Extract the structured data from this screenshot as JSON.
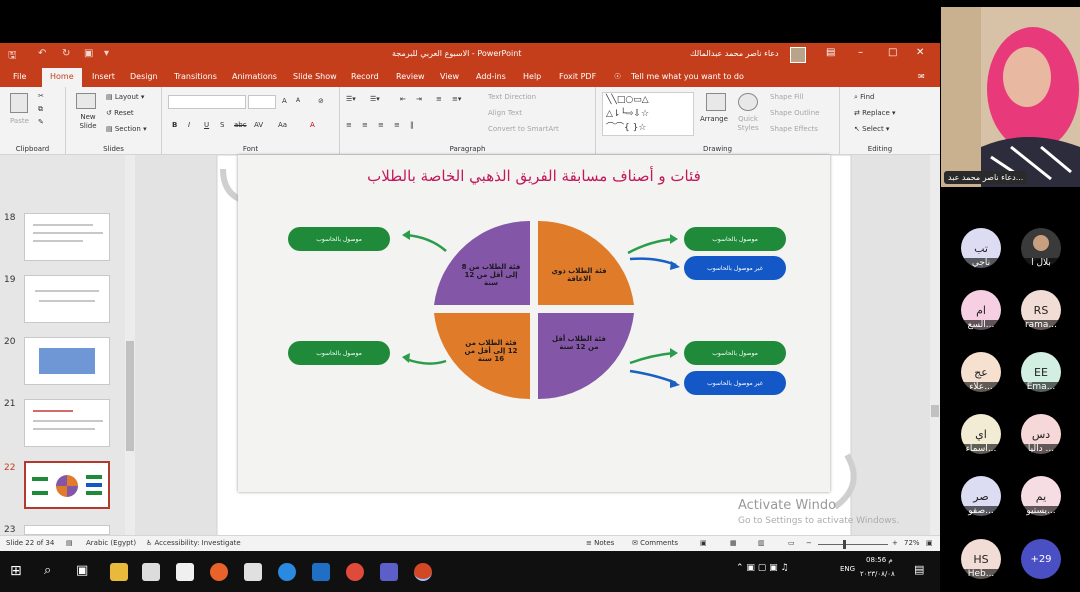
{
  "window": {
    "title": "الاسبوع العربي للبرمجة",
    "app_name": "PowerPoint",
    "user_name": "دعاء ناصر محمد عبدالمالك"
  },
  "tabs": [
    "File",
    "Home",
    "Insert",
    "Design",
    "Transitions",
    "Animations",
    "Slide Show",
    "Record",
    "Review",
    "View",
    "Add-ins",
    "Help",
    "Foxit PDF"
  ],
  "tell_me": "Tell me what you want to do",
  "ribbon": {
    "groups": [
      "Clipboard",
      "Slides",
      "Font",
      "Paragraph",
      "Drawing",
      "Editing"
    ],
    "clipboard": {
      "paste": "Paste"
    },
    "slides": {
      "new_slide": "New Slide",
      "layout": "Layout",
      "reset": "Reset",
      "section": "Section"
    },
    "font": {
      "bold": "B",
      "italic": "I",
      "underline": "U",
      "strike": "abc",
      "spacing": "AV",
      "case": "Aa",
      "grow": "A",
      "shrink": "A",
      "color": "A"
    },
    "paragraph": {
      "text_direction": "Text Direction",
      "align_text": "Align Text",
      "smartart": "Convert to SmartArt"
    },
    "drawing": {
      "arrange": "Arrange",
      "quick_styles": "Quick Styles",
      "fill": "Shape Fill",
      "outline": "Shape Outline",
      "effects": "Shape Effects"
    },
    "editing": {
      "find": "Find",
      "replace": "Replace",
      "select": "Select"
    }
  },
  "thumbnails": [
    {
      "num": "18",
      "selected": false
    },
    {
      "num": "19",
      "selected": false
    },
    {
      "num": "20",
      "selected": false
    },
    {
      "num": "21",
      "selected": false
    },
    {
      "num": "22",
      "selected": true
    },
    {
      "num": "23",
      "selected": false
    }
  ],
  "slide": {
    "title": "فئات و أصناف مسابقة الفريق الذهبي الخاصة بالطلاب",
    "q_tl": "فئة الطلاب من 8 إلى أقل من 12 سنة",
    "q_tr": "فئة الطلاب ذوي الاعاقة",
    "q_bl": "فئة الطلاب من 12 إلى أقل من 16 سنة",
    "q_br": "فئة الطلاب أقل من 12 سنة",
    "connected": "موصول بالحاسوب",
    "not_connected": "غير موصول بالحاسوب"
  },
  "colors": {
    "accent": "#c43e1c",
    "purple": "#8356a8",
    "orange": "#e07b2a",
    "green": "#1f8b3a",
    "blue": "#1458c8",
    "arrow_green": "#2a9d4a",
    "arrow_blue": "#1a5fc4"
  },
  "watermark": {
    "line1": "Activate Windo",
    "line2": "Go to Settings to activate Windows."
  },
  "status": {
    "slide_of": "Slide 22 of 34",
    "language": "Arabic (Egypt)",
    "accessibility": "Accessibility: Investigate",
    "notes": "Notes",
    "comments": "Comments",
    "zoom": "72%"
  },
  "taskbar": {
    "time": "08:56 م",
    "date": "٢٠٢٣/٠٨/٠٨",
    "lang": "ENG"
  },
  "meeting": {
    "presenter_name": "دعاء ناصر محمد عبد...",
    "participants": [
      {
        "initials": "تب",
        "name": "ناجي",
        "color": "#dcdcf2"
      },
      {
        "initials": "",
        "name": "بلال ا",
        "color": "#3a3a3a"
      },
      {
        "initials": "ام",
        "name": "السع...",
        "color": "#f6d0e2"
      },
      {
        "initials": "RS",
        "name": "rama...",
        "color": "#f2ddd6"
      },
      {
        "initials": "عج",
        "name": "علاء...",
        "color": "#f6e0d0"
      },
      {
        "initials": "EE",
        "name": "Ema...",
        "color": "#d2efe2"
      },
      {
        "initials": "اي",
        "name": "اسماء...",
        "color": "#f3ecd4"
      },
      {
        "initials": "دس",
        "name": "داليا ...",
        "color": "#f6d8d8"
      },
      {
        "initials": "صر",
        "name": "صفو...",
        "color": "#dcdcf2"
      },
      {
        "initials": "يم",
        "name": "يستيو...",
        "color": "#f6dde4"
      },
      {
        "initials": "HS",
        "name": "Heb...",
        "color": "#f2ddd6"
      }
    ],
    "more": "+29"
  }
}
